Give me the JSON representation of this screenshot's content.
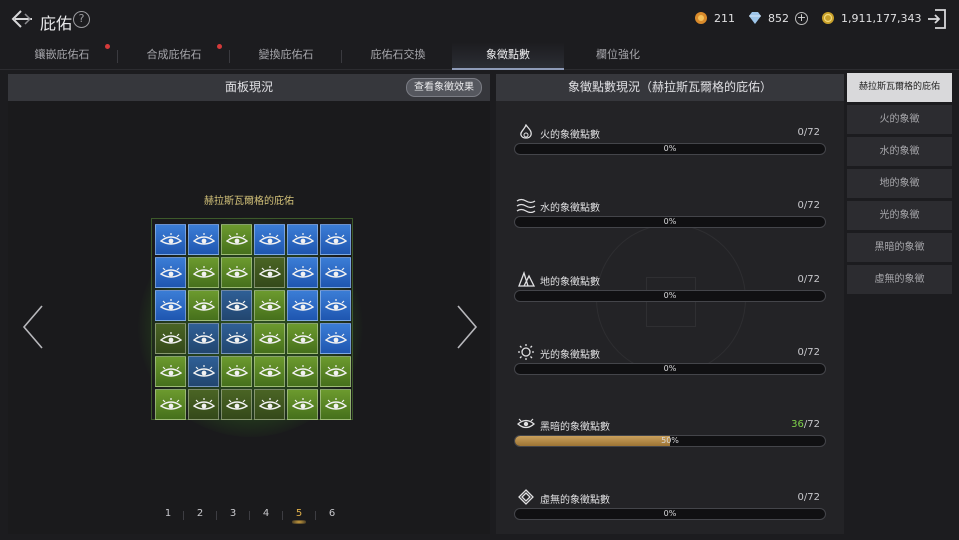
{
  "header": {
    "title": "庇佑",
    "help_label": "?"
  },
  "resources": {
    "gold_tokens": "211",
    "diamonds": "852",
    "coins": "1,911,177,343",
    "plus_label": "+"
  },
  "tabs": [
    {
      "label": "鑲嵌庇佑石",
      "dot": true
    },
    {
      "label": "合成庇佑石",
      "dot": true
    },
    {
      "label": "變換庇佑石",
      "dot": false
    },
    {
      "label": "庇佑石交換",
      "dot": false
    },
    {
      "label": "象徵點數",
      "dot": false,
      "active": true
    },
    {
      "label": "欄位強化",
      "dot": false
    }
  ],
  "board_panel": {
    "title": "面板現況",
    "effect_button": "查看象徵效果",
    "board_title": "赫拉斯瓦爾格的庇佑",
    "cells": [
      [
        "blue",
        "blue",
        "green",
        "blue",
        "blue",
        "blue"
      ],
      [
        "blue",
        "green",
        "green",
        "dkgreen",
        "blue",
        "blue"
      ],
      [
        "blue",
        "green",
        "dkblue",
        "green",
        "blue",
        "blue"
      ],
      [
        "dkgreen",
        "dkblue",
        "dkblue",
        "green",
        "green",
        "blue"
      ],
      [
        "green",
        "dkblue",
        "green",
        "green",
        "green",
        "green"
      ],
      [
        "green",
        "dkgreen",
        "dkgreen",
        "dkgreen",
        "green",
        "green"
      ]
    ],
    "pages": [
      "1",
      "2",
      "3",
      "4",
      "5",
      "6"
    ],
    "active_page": "5"
  },
  "points_panel": {
    "title": "象徵點數現況（赫拉斯瓦爾格的庇佑）",
    "rows": [
      {
        "icon": "fire-symbol-icon",
        "label": "火的象徵點數",
        "current": "0",
        "total": "/72",
        "percent_label": "0%",
        "fill": 0,
        "highlight": false
      },
      {
        "icon": "water-symbol-icon",
        "label": "水的象徵點數",
        "current": "0",
        "total": "/72",
        "percent_label": "0%",
        "fill": 0,
        "highlight": false
      },
      {
        "icon": "earth-symbol-icon",
        "label": "地的象徵點數",
        "current": "0",
        "total": "/72",
        "percent_label": "0%",
        "fill": 0,
        "highlight": false
      },
      {
        "icon": "light-symbol-icon",
        "label": "光的象徵點數",
        "current": "0",
        "total": "/72",
        "percent_label": "0%",
        "fill": 0,
        "highlight": false
      },
      {
        "icon": "dark-symbol-icon",
        "label": "黑暗的象徵點數",
        "current": "36",
        "total": "/72",
        "percent_label": "50%",
        "fill": 0.5,
        "highlight": true
      },
      {
        "icon": "void-symbol-icon",
        "label": "虛無的象徵點數",
        "current": "0",
        "total": "/72",
        "percent_label": "0%",
        "fill": 0,
        "highlight": false
      }
    ]
  },
  "right_list": [
    {
      "label": "赫拉斯瓦爾格的庇佑",
      "active": true
    },
    {
      "label": "火的象徵",
      "active": false
    },
    {
      "label": "水的象徵",
      "active": false
    },
    {
      "label": "地的象徵",
      "active": false
    },
    {
      "label": "光的象徵",
      "active": false
    },
    {
      "label": "黑暗的象徵",
      "active": false
    },
    {
      "label": "虛無的象徵",
      "active": false
    }
  ],
  "colors": {
    "accent_gold": "#e0b04a",
    "fill_gold": "#caa05c",
    "highlight_green": "#7ed14a",
    "cell_blue": "#3b7dd6",
    "cell_green": "#6c9a2e"
  }
}
